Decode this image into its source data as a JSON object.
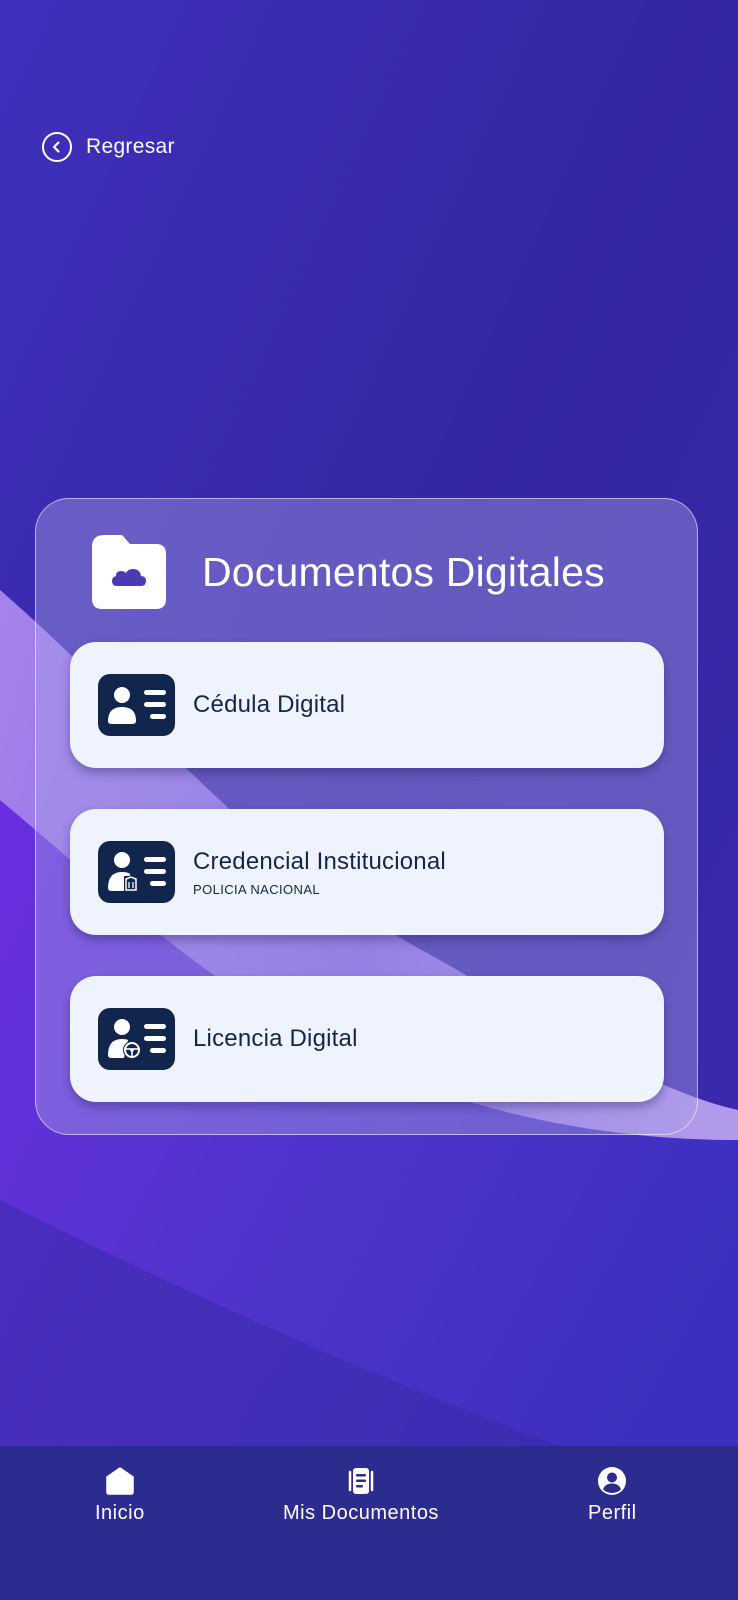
{
  "back": {
    "label": "Regresar",
    "icon": "chevron-left-circle-icon"
  },
  "card": {
    "title": "Documentos Digitales",
    "icon": "cloud-folder-icon",
    "items": [
      {
        "name": "Cédula Digital",
        "subtitle": "",
        "icon": "id-card-icon"
      },
      {
        "name": "Credencial Institucional",
        "subtitle": "POLICIA NACIONAL",
        "icon": "institutional-id-icon"
      },
      {
        "name": "Licencia Digital",
        "subtitle": "",
        "icon": "driver-license-icon"
      }
    ]
  },
  "nav": {
    "items": [
      {
        "label": "Inicio",
        "icon": "home-icon"
      },
      {
        "label": "Mis Documentos",
        "icon": "documents-icon"
      },
      {
        "label": "Perfil",
        "icon": "profile-icon"
      }
    ]
  },
  "colors": {
    "background": "#3a2bb0",
    "nav_background": "#2c2c8f",
    "card_item_background": "#eef3fd",
    "icon_dark": "#12264d",
    "text_dark": "#12264d",
    "text_light": "#ffffff"
  }
}
